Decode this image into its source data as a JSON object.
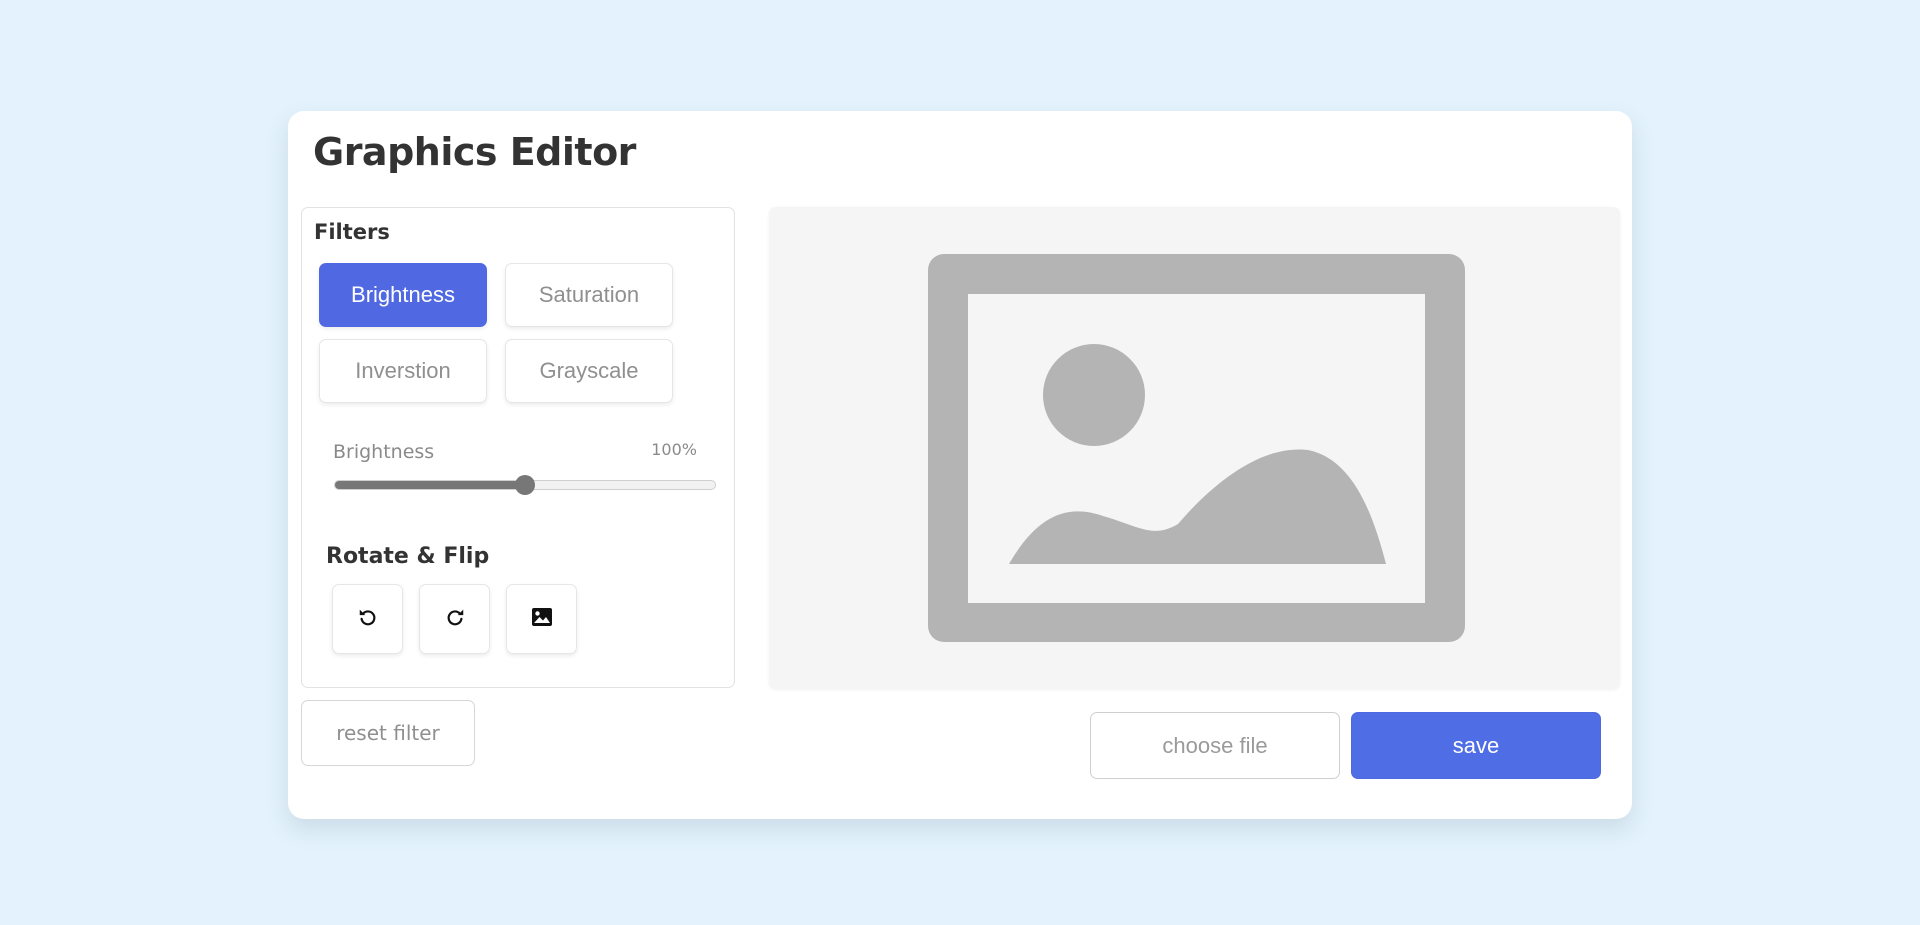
{
  "app": {
    "title": "Graphics Editor"
  },
  "filters": {
    "label": "Filters",
    "buttons": [
      {
        "label": "Brightness",
        "active": true
      },
      {
        "label": "Saturation",
        "active": false
      },
      {
        "label": "Inverstion",
        "active": false
      },
      {
        "label": "Grayscale",
        "active": false
      }
    ]
  },
  "slider": {
    "name": "Brightness",
    "value_text": "100%",
    "fraction": 0.5
  },
  "rotate": {
    "label": "Rotate & Flip",
    "buttons": [
      {
        "icon": "rotate-left-icon"
      },
      {
        "icon": "rotate-right-icon"
      },
      {
        "icon": "image-flip-icon"
      }
    ]
  },
  "actions": {
    "reset_label": "reset filter",
    "choose_label": "choose file",
    "save_label": "save"
  },
  "colors": {
    "accent": "#5069e3",
    "save": "#4f6ee6",
    "background": "#e3f2fc",
    "placeholder": "#b4b4b4"
  }
}
